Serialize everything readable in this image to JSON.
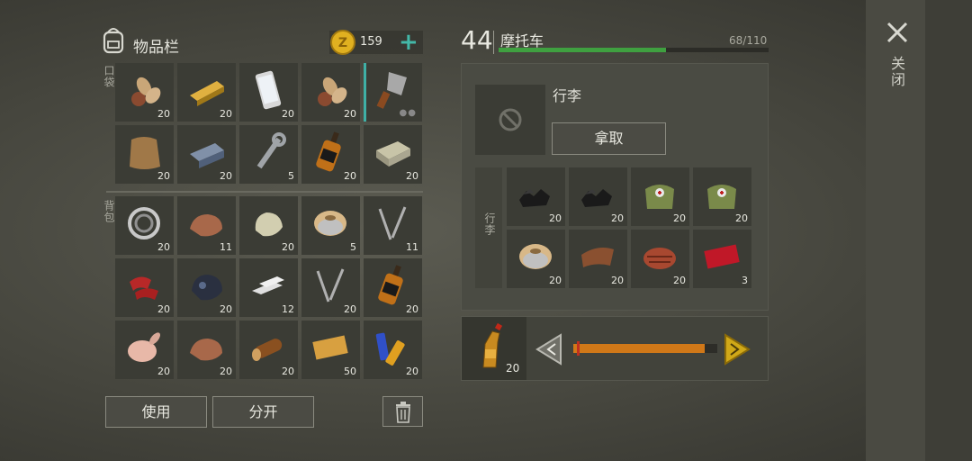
{
  "inventory": {
    "title": "物品栏",
    "coins": "159",
    "plus": "+",
    "pockets_label": "口袋",
    "backpack_label": "背包",
    "pocket_items": [
      {
        "icon": "nuts-icon",
        "count": "20"
      },
      {
        "icon": "gold-bar-icon",
        "count": "20"
      },
      {
        "icon": "smartphone-icon",
        "count": "20"
      },
      {
        "icon": "nuts-icon",
        "count": "20"
      },
      {
        "icon": "cleaver-icon",
        "count": "",
        "selected": true
      },
      {
        "icon": "animal-hide-icon",
        "count": "20"
      },
      {
        "icon": "iron-ingot-icon",
        "count": "20"
      },
      {
        "icon": "wrench-icon",
        "count": "5"
      },
      {
        "icon": "whiskey-bottle-icon",
        "count": "20"
      },
      {
        "icon": "stone-block-icon",
        "count": "20"
      }
    ],
    "backpack_items": [
      {
        "icon": "bearing-icon",
        "count": "20"
      },
      {
        "icon": "iron-ore-icon",
        "count": "11"
      },
      {
        "icon": "stone-icon",
        "count": "20"
      },
      {
        "icon": "wire-spool-icon",
        "count": "5"
      },
      {
        "icon": "nails-icon",
        "count": "11"
      },
      {
        "icon": "raw-meat-icon",
        "count": "20"
      },
      {
        "icon": "coal-ore-icon",
        "count": "20"
      },
      {
        "icon": "silver-bars-icon",
        "count": "12"
      },
      {
        "icon": "nails-icon",
        "count": "20"
      },
      {
        "icon": "whiskey-bottle-icon",
        "count": "20"
      },
      {
        "icon": "raw-chicken-icon",
        "count": "20"
      },
      {
        "icon": "iron-ore-icon",
        "count": "20"
      },
      {
        "icon": "log-icon",
        "count": "20"
      },
      {
        "icon": "ticket-icon",
        "count": "50"
      },
      {
        "icon": "batteries-icon",
        "count": "20"
      }
    ],
    "use_label": "使用",
    "split_label": "分开"
  },
  "vehicle": {
    "level": "44",
    "name": "摩托车",
    "capacity": "68/110",
    "capacity_fraction": 0.62,
    "luggage_title": "行李",
    "take_label": "拿取",
    "luggage_side_label": "行李",
    "luggage_items": [
      {
        "icon": "coal-icon",
        "count": "20"
      },
      {
        "icon": "coal-icon",
        "count": "20"
      },
      {
        "icon": "medkit-bag-icon",
        "count": "20"
      },
      {
        "icon": "medkit-bag-icon",
        "count": "20"
      },
      {
        "icon": "wire-spool-icon",
        "count": "20"
      },
      {
        "icon": "leather-icon",
        "count": "20"
      },
      {
        "icon": "steak-icon",
        "count": "20"
      },
      {
        "icon": "coupon-icon",
        "count": "3"
      }
    ],
    "fuel_count": "20",
    "fuel_fraction": 0.91
  },
  "close_label": "关闭",
  "colors": {
    "accent": "#43b8a8",
    "hp": "#3fa040",
    "slider": "#d07818",
    "arrow": "#d0a818"
  }
}
